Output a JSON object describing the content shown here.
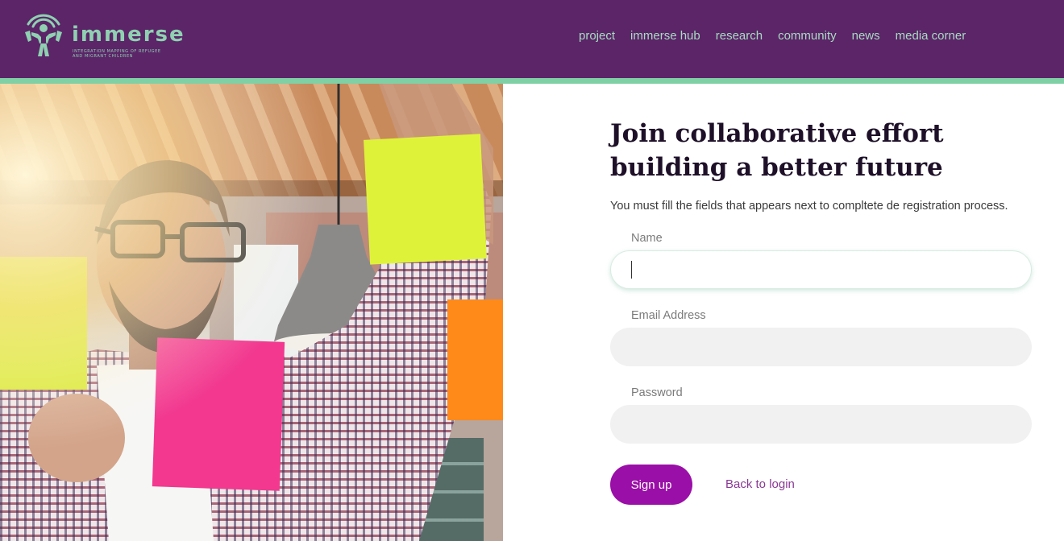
{
  "brand": {
    "name": "immerse",
    "tagline_line1": "Integration mapping of refugee",
    "tagline_line2": "and migrant children",
    "color_primary": "#5b2568",
    "color_accent": "#7fd0a4",
    "logo_icon": "immerse-logo-icon"
  },
  "nav": {
    "items": [
      {
        "label": "project"
      },
      {
        "label": "immerse hub"
      },
      {
        "label": "research"
      },
      {
        "label": "community"
      },
      {
        "label": "news"
      },
      {
        "label": "media corner"
      }
    ]
  },
  "hero": {
    "description_icon": "team-brainstorm-photo"
  },
  "form": {
    "title_line1": "Join collaborative effort",
    "title_line2": "building a better future",
    "subtitle": "You must fill the fields that appears next to compltete de registration process.",
    "name_label": "Name",
    "name_value": "",
    "email_label": "Email Address",
    "email_value": "",
    "password_label": "Password",
    "password_value": "",
    "signup_label": "Sign up",
    "back_label": "Back to login",
    "button_color": "#9a0fa7"
  }
}
